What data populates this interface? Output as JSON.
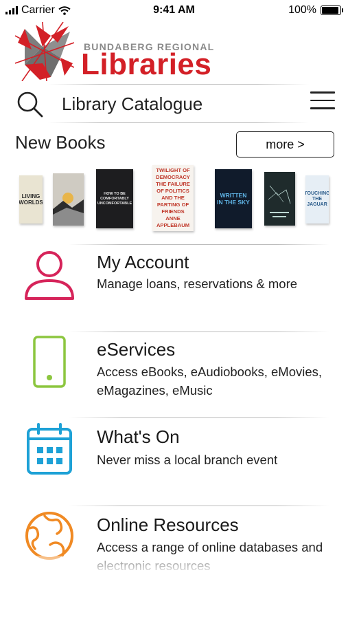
{
  "status_bar": {
    "carrier": "Carrier",
    "time": "9:41 AM",
    "battery": "100%",
    "battery_level": 1.0
  },
  "logo": {
    "line1": "BUNDABERG REGIONAL",
    "line2": "Libraries"
  },
  "search": {
    "label": "Library Catalogue"
  },
  "new_books": {
    "title": "New Books",
    "more_label": "more >",
    "books": [
      {
        "text": "LIVING WORLDS",
        "bg": "#e9e4d2",
        "fg": "#2b2b2b"
      },
      {
        "text": "",
        "bg": "#d9d6cf",
        "fg": "#333333"
      },
      {
        "text": "HOW TO BE COMFORTABLY UNCOMFORTABLE",
        "bg": "#1d1d1f",
        "fg": "#e8e8e8"
      },
      {
        "text": "TWILIGHT OF DEMOCRACY THE FAILURE OF POLITICS AND THE PARTING OF FRIENDS ANNE APPLEBAUM",
        "bg": "#f7f3ee",
        "fg": "#c0392b"
      },
      {
        "text": "WRITTEN IN THE SKY",
        "bg": "#101b2b",
        "fg": "#5fb4e6"
      },
      {
        "text": "",
        "bg": "#1f2b2c",
        "fg": "#bcd8d3"
      },
      {
        "text": "TOUCHING THE JAGUAR",
        "bg": "#e6eef5",
        "fg": "#2a5b8a"
      }
    ]
  },
  "menu": [
    {
      "id": "account",
      "title": "My Account",
      "description": "Manage loans, reservations & more",
      "icon": "person-icon",
      "color": "#d6245a"
    },
    {
      "id": "eservices",
      "title": "eServices",
      "description": "Access eBooks, eAudiobooks, eMovies, eMagazines, eMusic",
      "icon": "phone-icon",
      "color": "#8cc63f"
    },
    {
      "id": "whatson",
      "title": "What's On",
      "description": "Never miss a local branch event",
      "icon": "calendar-icon",
      "color": "#1da1d6"
    },
    {
      "id": "resources",
      "title": "Online Resources",
      "description": "Access a range of online databases and electronic resources",
      "icon": "globe-icon",
      "color": "#f08a24"
    }
  ]
}
